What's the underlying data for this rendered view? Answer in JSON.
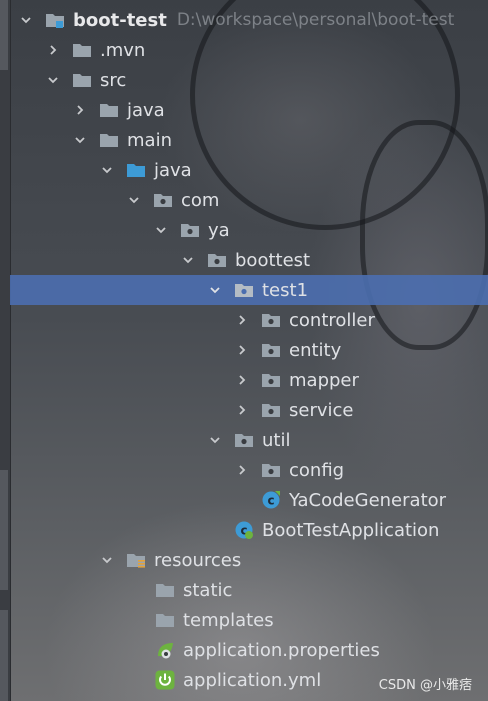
{
  "project": {
    "name": "boot-test",
    "path": "D:\\workspace\\personal\\boot-test"
  },
  "tree": {
    "mvn": ".mvn",
    "src": "src",
    "java_top": "java",
    "main": "main",
    "java": "java",
    "com": "com",
    "ya": "ya",
    "boottest": "boottest",
    "test1": "test1",
    "controller": "controller",
    "entity": "entity",
    "mapper": "mapper",
    "service": "service",
    "util": "util",
    "config": "config",
    "ya_code_generator": "YaCodeGenerator",
    "boot_test_application": "BootTestApplication",
    "resources": "resources",
    "static": "static",
    "templates": "templates",
    "application_properties": "application.properties",
    "application_yml": "application.yml"
  },
  "colors": {
    "selection": "#4b6eaf",
    "folder": "#9aa4ad",
    "source_folder": "#3d9bd6",
    "class_icon": "#3d9bd6",
    "spring_green": "#6db33f"
  },
  "watermark": "CSDN @小雅痞"
}
